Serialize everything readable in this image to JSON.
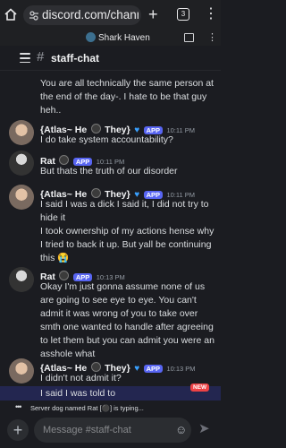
{
  "browser": {
    "url": "discord.com/chann",
    "tab_count": "3",
    "new_tab_glyph": "+",
    "menu_glyph": "⋮"
  },
  "server": {
    "name": "Shark Haven"
  },
  "channel": {
    "name": "staff-chat",
    "hash_glyph": "#"
  },
  "messages": [
    {
      "type": "continuation",
      "text": "You are all technically the same person at the end of the day-. I hate to be that guy heh.."
    },
    {
      "author": "{Atlas~ He",
      "author_suffix": "They}",
      "badge": "APP",
      "time": "10:11 PM",
      "lines": [
        "I do take system accountability?"
      ]
    },
    {
      "author": "Rat",
      "badge": "APP",
      "time": "10:11 PM",
      "lines": [
        "But thats the truth of our disorder"
      ]
    },
    {
      "author": "{Atlas~ He",
      "author_suffix": "They}",
      "badge": "APP",
      "time": "10:11 PM",
      "lines": [
        "I said I was a dick I said it, I did not try to hide it",
        "I took ownership of my actions hense why I tried to back it up. But yall be continuing this 😭"
      ]
    },
    {
      "author": "Rat",
      "badge": "APP",
      "time": "10:13 PM",
      "lines": [
        "Okay I'm just gonna assume none of us are going to see eye to eye. You can't admit it was wrong of you to take over smth one wanted to handle after agreeing to let them but you can admit you were an asshole what"
      ]
    },
    {
      "author": "{Atlas~ He",
      "author_suffix": "They}",
      "badge": "APP",
      "time": "10:13 PM",
      "lines": [
        "I didn't not admit it?",
        "I said I was told to"
      ]
    }
  ],
  "new_badge": "NEW",
  "typing": "Server dog named Rat [⚫] is typing...",
  "composer": {
    "placeholder": "Message #staff-chat",
    "plus_glyph": "+",
    "emoji_glyph": "☺",
    "send_glyph": "➤"
  },
  "colors": {
    "accent": "#5865f2",
    "heart": "#39a0ff",
    "new_badge": "#ed4245"
  }
}
